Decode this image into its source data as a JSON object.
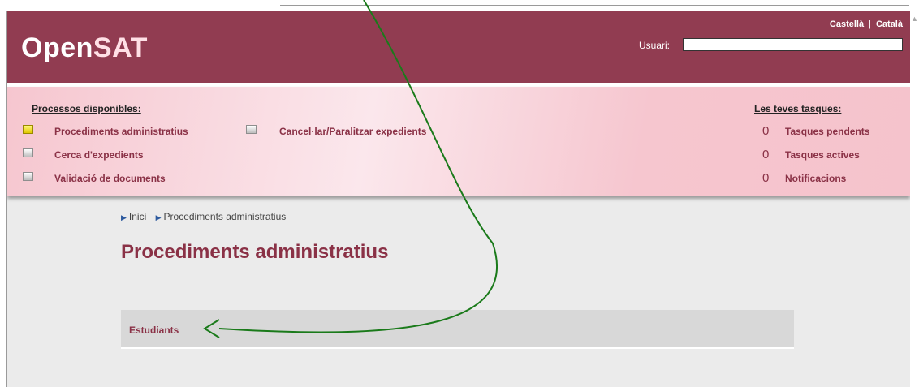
{
  "header": {
    "logo_open": "Open",
    "logo_sat": "SAT",
    "lang_es": "Castellà",
    "lang_sep": "|",
    "lang_ca": "Català",
    "user_label": "Usuari:",
    "user_value": ""
  },
  "processes": {
    "title": "Processos disponibles:",
    "items": [
      "Procediments administratius",
      "Cancel·lar/Paralitzar expedients",
      "Cerca d'expedients",
      "Validació de documents"
    ]
  },
  "tasks": {
    "title": "Les teves tasques:",
    "items": [
      {
        "count": "0",
        "label": "Tasques pendents"
      },
      {
        "count": "0",
        "label": "Tasques actives"
      },
      {
        "count": "0",
        "label": "Notificacions"
      }
    ]
  },
  "breadcrumb": [
    "Inici",
    "Procediments administratius"
  ],
  "main": {
    "title": "Procediments administratius",
    "list_item": "Estudiants"
  },
  "colors": {
    "brand": "#913c51",
    "accent": "#8a3146",
    "panel": "#f6c6cf",
    "annotation": "#1a7a1a"
  },
  "icons": [
    "checkbox-icon",
    "breadcrumb-arrow-icon",
    "annotation-arrow-icon"
  ]
}
